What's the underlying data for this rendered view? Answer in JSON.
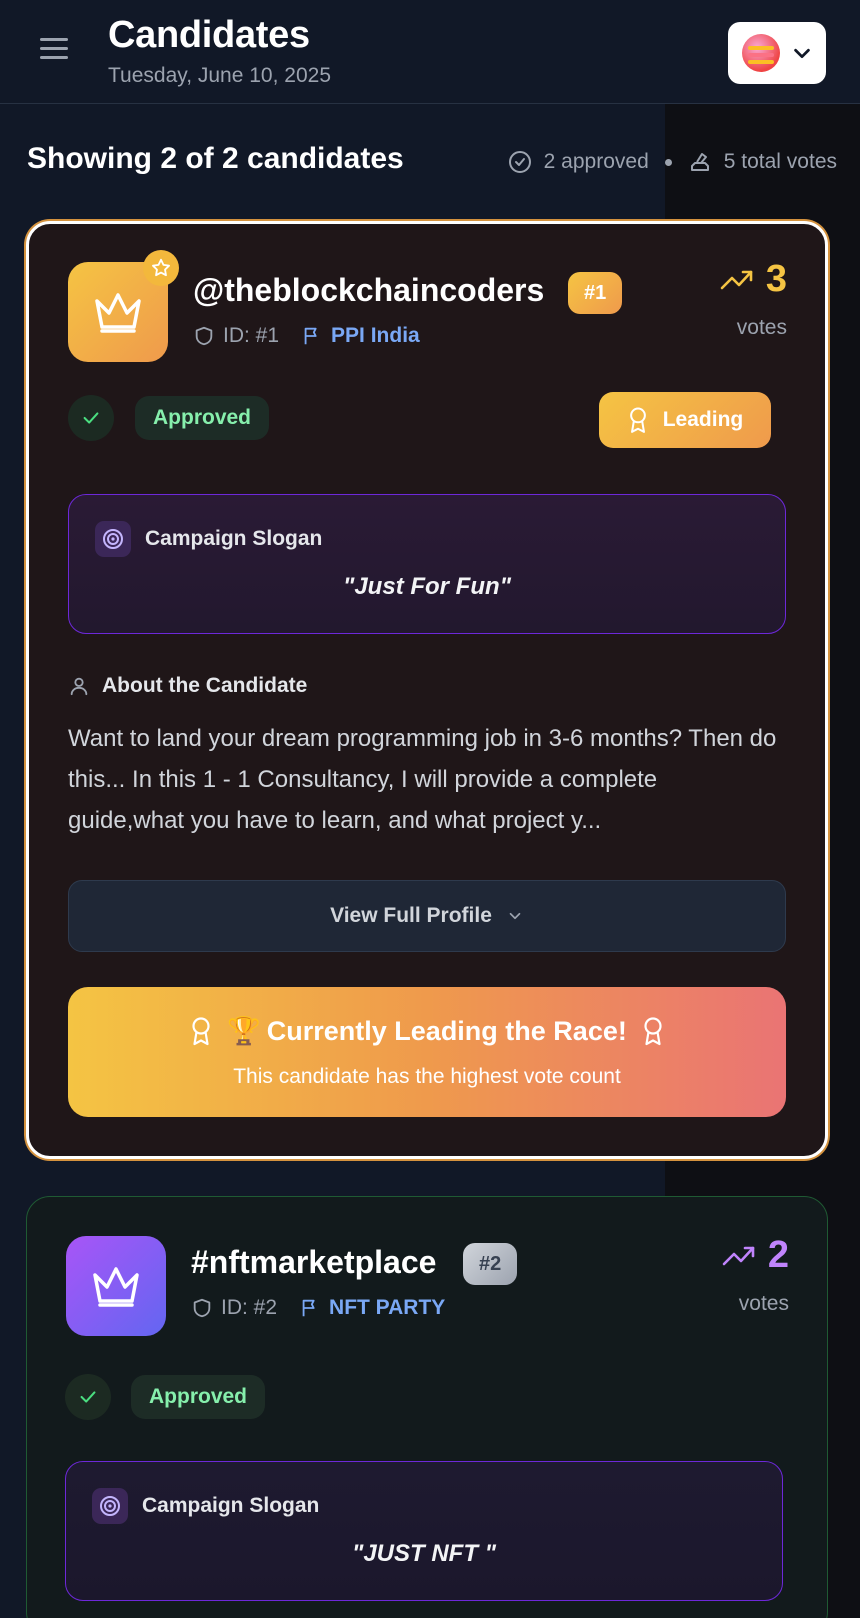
{
  "header": {
    "title": "Candidates",
    "date": "Tuesday, June 10, 2025"
  },
  "summary": {
    "showing": "Showing 2 of 2 candidates",
    "approved": "2 approved",
    "total_votes": "5 total votes"
  },
  "colors": {
    "gold": "#f5c443",
    "orange": "#ef9a4c",
    "purple": "#a855f7",
    "green": "#86efac",
    "party_blue": "#7aa8f5"
  },
  "candidates": [
    {
      "name": "@theblockchaincoders",
      "rank": "#1",
      "id": "ID: #1",
      "party": "PPI India",
      "votes": "3",
      "votes_label": "votes",
      "status": "Approved",
      "leading_label": "Leading",
      "slogan_heading": "Campaign Slogan",
      "slogan": "\"Just For Fun\"",
      "about_heading": "About the Candidate",
      "about": "Want to land your dream programming job in 3-6 months? Then do this... In this 1 - 1 Consultancy, I will provide a complete guide,what you have to learn, and what project y...",
      "view_profile": "View Full Profile",
      "race_title": "Currently Leading the Race!",
      "race_trophy": "🏆",
      "race_sub": "This candidate has the highest vote count"
    },
    {
      "name": "#nftmarketplace",
      "rank": "#2",
      "id": "ID: #2",
      "party": "NFT PARTY",
      "votes": "2",
      "votes_label": "votes",
      "status": "Approved",
      "slogan_heading": "Campaign Slogan",
      "slogan": "\"JUST NFT \""
    }
  ]
}
